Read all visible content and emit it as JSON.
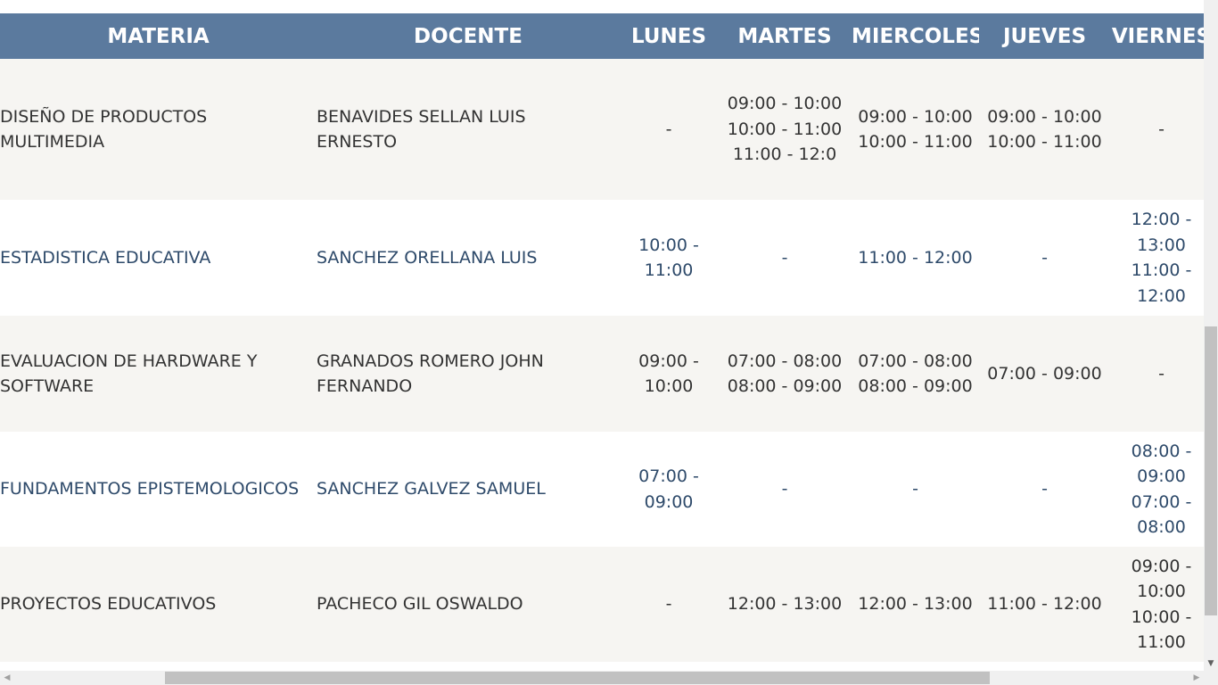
{
  "table": {
    "headers": {
      "materia": "MATERIA",
      "docente": "DOCENTE",
      "lunes": "LUNES",
      "martes": "MARTES",
      "miercoles": "MIERCOLES",
      "jueves": "JUEVES",
      "viernes": "VIERNES"
    },
    "rows": [
      {
        "materia": "DISEÑO DE PRODUCTOS MULTIMEDIA",
        "docente": "BENAVIDES SELLAN LUIS ERNESTO",
        "lunes": [
          "-"
        ],
        "martes": [
          "09:00 - 10:00",
          "10:00 - 11:00",
          "11:00 - 12:0"
        ],
        "miercoles": [
          "09:00 - 10:00",
          "10:00 - 11:00"
        ],
        "jueves": [
          "09:00 - 10:00",
          "10:00 - 11:00"
        ],
        "viernes": [
          "-"
        ]
      },
      {
        "materia": "ESTADISTICA EDUCATIVA",
        "docente": "SANCHEZ ORELLANA LUIS",
        "lunes": [
          "10:00 - 11:00"
        ],
        "martes": [
          "-"
        ],
        "miercoles": [
          "11:00 - 12:00"
        ],
        "jueves": [
          "-"
        ],
        "viernes": [
          "12:00 - 13:00",
          "11:00 - 12:00"
        ]
      },
      {
        "materia": "EVALUACION DE HARDWARE Y SOFTWARE",
        "docente": "GRANADOS ROMERO JOHN FERNANDO",
        "lunes": [
          "09:00 - 10:00"
        ],
        "martes": [
          "07:00 - 08:00",
          "08:00 - 09:00"
        ],
        "miercoles": [
          "07:00 - 08:00",
          "08:00 - 09:00"
        ],
        "jueves": [
          "07:00 - 09:00"
        ],
        "viernes": [
          "-"
        ]
      },
      {
        "materia": "FUNDAMENTOS EPISTEMOLOGICOS",
        "docente": "SANCHEZ GALVEZ SAMUEL",
        "lunes": [
          "07:00 - 09:00"
        ],
        "martes": [
          "-"
        ],
        "miercoles": [
          "-"
        ],
        "jueves": [
          "-"
        ],
        "viernes": [
          "08:00 - 09:00",
          "07:00 - 08:00"
        ]
      },
      {
        "materia": "PROYECTOS EDUCATIVOS",
        "docente": "PACHECO GIL OSWALDO",
        "lunes": [
          "-"
        ],
        "martes": [
          "12:00 - 13:00"
        ],
        "miercoles": [
          "12:00 - 13:00"
        ],
        "jueves": [
          "11:00 - 12:00"
        ],
        "viernes": [
          "09:00 - 10:00",
          "10:00 - 11:00"
        ]
      }
    ]
  },
  "colors": {
    "header_bg": "#5b7a9e",
    "header_text": "#ffffff",
    "row_odd_bg": "#f6f5f2",
    "row_even_bg": "#ffffff",
    "row_odd_text": "#333333",
    "row_even_text": "#2e4a6a"
  },
  "icons": {
    "scroll_left": "◀",
    "scroll_right": "▶",
    "scroll_down": "▼"
  }
}
